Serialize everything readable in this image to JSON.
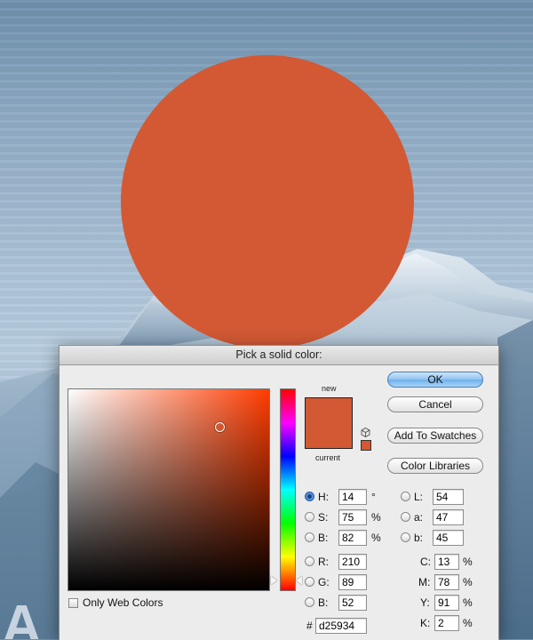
{
  "dialog": {
    "title": "Pick a solid color:",
    "new_label": "new",
    "current_label": "current",
    "only_web_colors_label": "Only Web Colors",
    "only_web_colors_checked": false,
    "buttons": {
      "ok": "OK",
      "cancel": "Cancel",
      "add_to_swatches": "Add To Swatches",
      "color_libraries": "Color Libraries"
    },
    "hsb": {
      "h": {
        "label": "H:",
        "value": "14",
        "unit": "°",
        "selected": true
      },
      "s": {
        "label": "S:",
        "value": "75",
        "unit": "%",
        "selected": false
      },
      "b": {
        "label": "B:",
        "value": "82",
        "unit": "%",
        "selected": false
      }
    },
    "rgb": {
      "r": {
        "label": "R:",
        "value": "210"
      },
      "g": {
        "label": "G:",
        "value": "89"
      },
      "b": {
        "label": "B:",
        "value": "52"
      }
    },
    "lab": {
      "l": {
        "label": "L:",
        "value": "54"
      },
      "a": {
        "label": "a:",
        "value": "47"
      },
      "b": {
        "label": "b:",
        "value": "45"
      }
    },
    "cmyk": {
      "c": {
        "label": "C:",
        "value": "13",
        "unit": "%"
      },
      "m": {
        "label": "M:",
        "value": "78",
        "unit": "%"
      },
      "y": {
        "label": "Y:",
        "value": "91",
        "unit": "%"
      },
      "k": {
        "label": "K:",
        "value": "2",
        "unit": "%"
      }
    },
    "hex": {
      "label": "#",
      "value": "d25934"
    }
  },
  "colors": {
    "selected": "#d25934",
    "field_hue": "#ff3c00",
    "ok_accent": "#6eafea"
  },
  "background": {
    "partial_text": "A"
  }
}
